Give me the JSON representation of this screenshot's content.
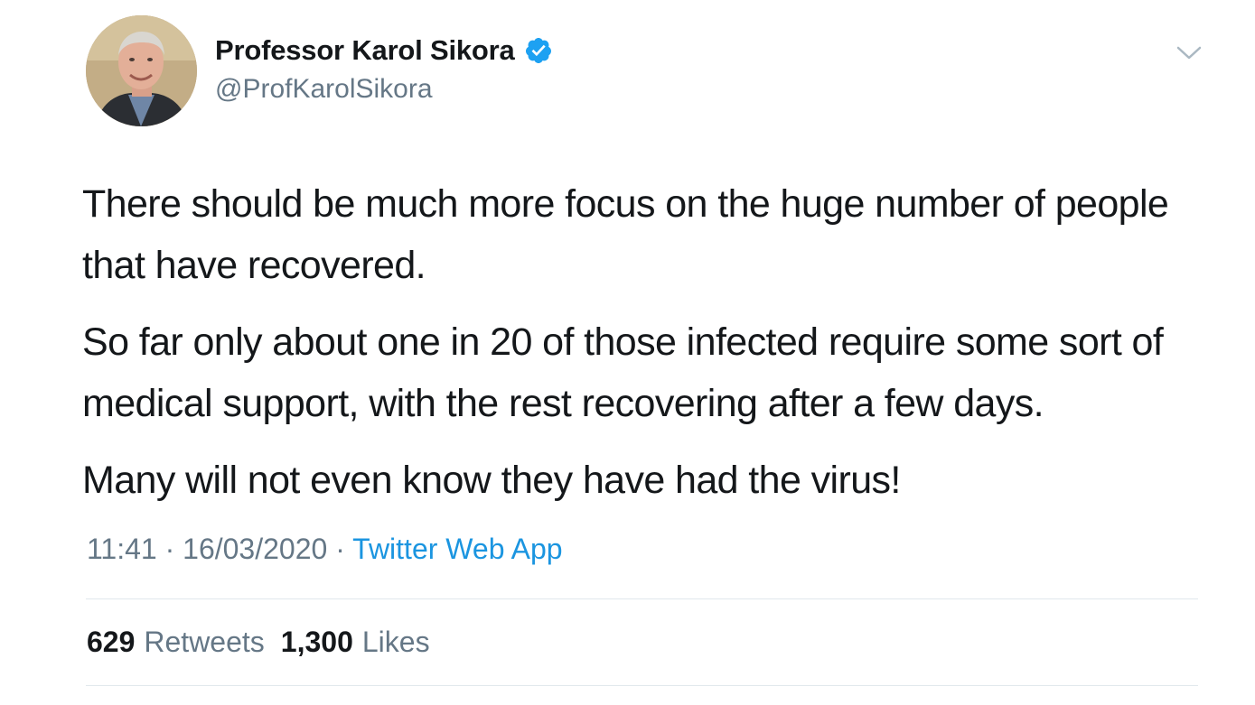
{
  "author": {
    "display_name": "Professor Karol Sikora",
    "handle": "@ProfKarolSikora",
    "verified": true,
    "avatar_icon": "profile-photo"
  },
  "tweet": {
    "paragraphs": [
      "There should be much more focus on the huge number of people that have recovered.",
      "So far only about one in 20 of those infected require some sort of medical support, with the rest recovering after a few days.",
      "Many will not even know they have had the virus!"
    ]
  },
  "meta": {
    "time": "11:41",
    "separator": "·",
    "date": "16/03/2020",
    "source": "Twitter Web App"
  },
  "stats": {
    "retweets_count": "629",
    "retweets_label": "Retweets",
    "likes_count": "1,300",
    "likes_label": "Likes"
  },
  "colors": {
    "text": "#14171a",
    "secondary": "#657786",
    "link": "#1b95e0",
    "verified_badge": "#1da1f2",
    "divider": "#e1e8ed"
  },
  "icons": {
    "verified": "verified-badge-icon",
    "menu": "chevron-down-icon"
  }
}
